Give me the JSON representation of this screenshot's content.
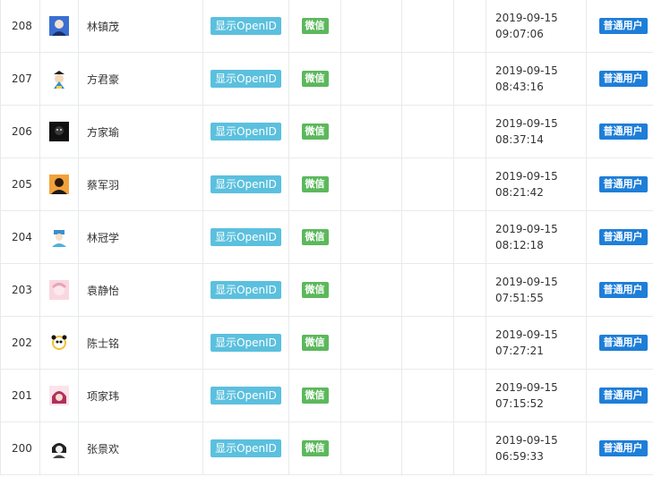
{
  "colors": {
    "openid_button": "#5bc0de",
    "wechat_tag": "#5cb85c",
    "role_tag": "#1e7ed8",
    "border": "#e7eaec"
  },
  "rows": [
    {
      "id": "208",
      "name": "林镇茂",
      "openid_label": "显示OpenID",
      "source": "微信",
      "date": "2019-09-15",
      "time": "09:07:06",
      "role": "普通用户",
      "avatar_color": "#3a6fd1"
    },
    {
      "id": "207",
      "name": "方君豪",
      "openid_label": "显示OpenID",
      "source": "微信",
      "date": "2019-09-15",
      "time": "08:43:16",
      "role": "普通用户",
      "avatar_color": "#f3d04b"
    },
    {
      "id": "206",
      "name": "方家瑜",
      "openid_label": "显示OpenID",
      "source": "微信",
      "date": "2019-09-15",
      "time": "08:37:14",
      "role": "普通用户",
      "avatar_color": "#2b2b2b"
    },
    {
      "id": "205",
      "name": "蔡军羽",
      "openid_label": "显示OpenID",
      "source": "微信",
      "date": "2019-09-15",
      "time": "08:21:42",
      "role": "普通用户",
      "avatar_color": "#e8892a"
    },
    {
      "id": "204",
      "name": "林冠学",
      "openid_label": "显示OpenID",
      "source": "微信",
      "date": "2019-09-15",
      "time": "08:12:18",
      "role": "普通用户",
      "avatar_color": "#4fb0d8"
    },
    {
      "id": "203",
      "name": "袁静怡",
      "openid_label": "显示OpenID",
      "source": "微信",
      "date": "2019-09-15",
      "time": "07:51:55",
      "role": "普通用户",
      "avatar_color": "#f4b8c8"
    },
    {
      "id": "202",
      "name": "陈士铭",
      "openid_label": "显示OpenID",
      "source": "微信",
      "date": "2019-09-15",
      "time": "07:27:21",
      "role": "普通用户",
      "avatar_color": "#e8c13a"
    },
    {
      "id": "201",
      "name": "项家玮",
      "openid_label": "显示OpenID",
      "source": "微信",
      "date": "2019-09-15",
      "time": "07:15:52",
      "role": "普通用户",
      "avatar_color": "#c0436a"
    },
    {
      "id": "200",
      "name": "张景欢",
      "openid_label": "显示OpenID",
      "source": "微信",
      "date": "2019-09-15",
      "time": "06:59:33",
      "role": "普通用户",
      "avatar_color": "#555555"
    }
  ]
}
